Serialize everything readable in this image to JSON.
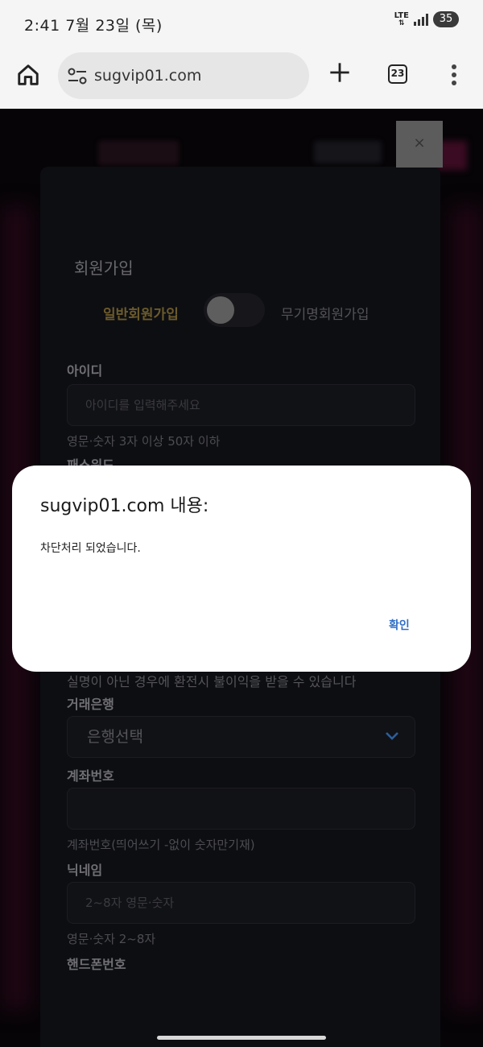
{
  "status_bar": {
    "time": "2:41 7월 23일 (목)",
    "network": "LTE",
    "battery": "35"
  },
  "browser": {
    "url": "sugvip01.com",
    "tab_count": "23"
  },
  "page": {
    "close_label": "×",
    "form_title": "회원가입",
    "tab_normal": "일반회원가입",
    "tab_anonymous": "무기명회원가입",
    "id_label": "아이디",
    "id_placeholder": "아이디를 입력해주세요",
    "id_help": "영문·숫자 3자 이상 50자 이하",
    "password_label_partial": "패스워드",
    "realname_notice": "실명이 아닌 경우에 환전시 불이익을 받을 수 있습니다",
    "bank_label": "거래은행",
    "bank_select": "은행선택",
    "account_label": "계좌번호",
    "account_value": "",
    "account_help": "계좌번호(띄어쓰기 -없이 숫자만기재)",
    "nickname_label": "닉네임",
    "nickname_placeholder": "2~8자 영문·숫자",
    "nickname_help": "영문·숫자 2~8자",
    "phone_label": "핸드폰번호"
  },
  "dialog": {
    "title": "sugvip01.com 내용:",
    "message": "차단처리 되었습니다.",
    "ok_label": "확인",
    "ok_color": "#2f6fc6"
  }
}
